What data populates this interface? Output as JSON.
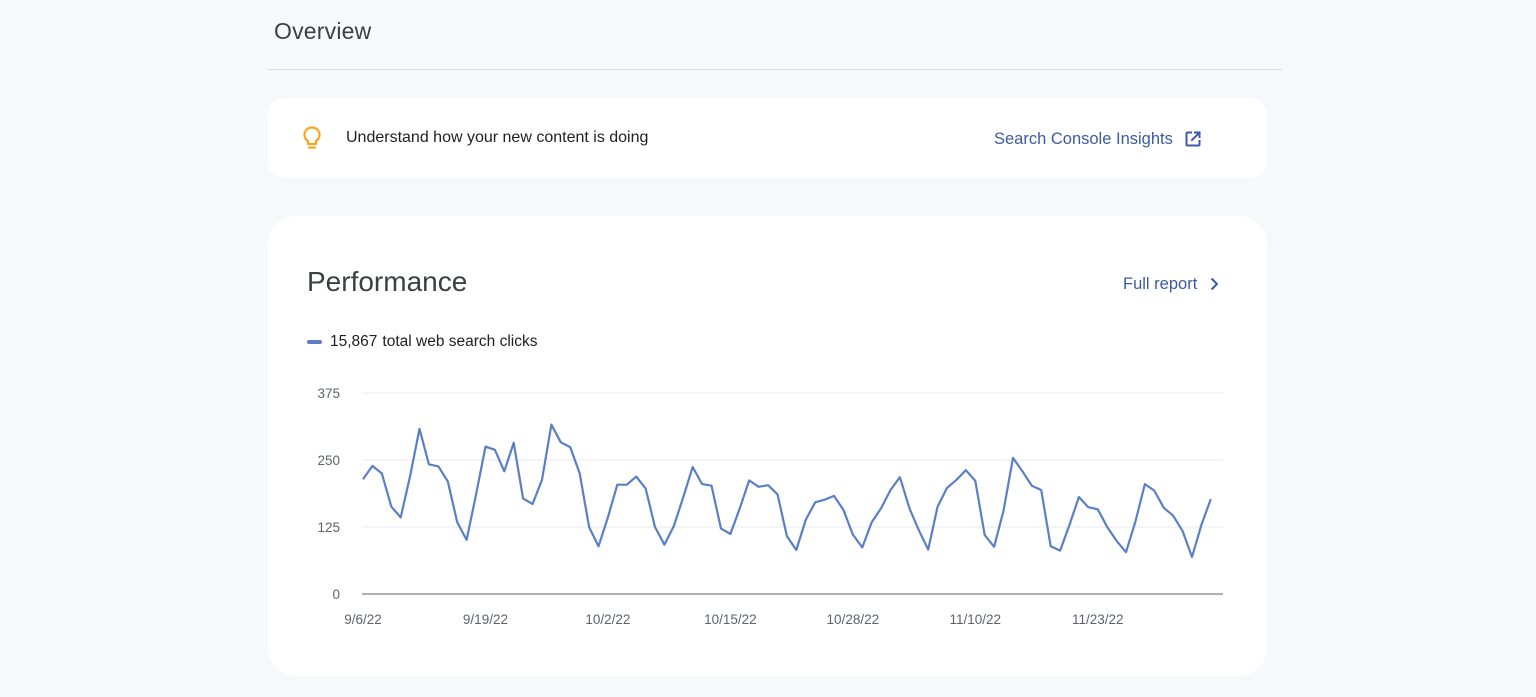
{
  "overview": {
    "title": "Overview"
  },
  "insights": {
    "message": "Understand how your new content is doing",
    "link_label": "Search Console Insights",
    "icon": "lightbulb-icon",
    "link_icon": "open-in-new-icon"
  },
  "performance": {
    "title": "Performance",
    "full_report_label": "Full report",
    "full_report_icon": "chevron-right-icon",
    "legend": {
      "value": "15,867",
      "label": "total web search clicks"
    }
  },
  "colors": {
    "accent": "#3c5aa6",
    "series": "#5b7fc5",
    "bulb": "#f5a623"
  },
  "chart_data": {
    "type": "line",
    "ylim": [
      0,
      375
    ],
    "yticks": [
      0,
      125,
      250,
      375
    ],
    "xticks": [
      "9/6/22",
      "9/19/22",
      "10/2/22",
      "10/15/22",
      "10/28/22",
      "11/10/22",
      "11/23/22"
    ],
    "grid": true,
    "series": [
      {
        "name": "total web search clicks",
        "start_date": "9/6/22",
        "values": [
          214,
          239,
          225,
          163,
          143,
          220,
          308,
          242,
          238,
          210,
          134,
          101,
          185,
          275,
          269,
          229,
          282,
          178,
          168,
          213,
          316,
          283,
          274,
          225,
          125,
          89,
          143,
          204,
          204,
          219,
          197,
          125,
          92,
          127,
          181,
          237,
          205,
          202,
          122,
          112,
          160,
          212,
          200,
          203,
          186,
          108,
          82,
          138,
          171,
          176,
          183,
          157,
          111,
          87,
          134,
          160,
          194,
          218,
          160,
          119,
          83,
          163,
          198,
          213,
          231,
          211,
          110,
          88,
          156,
          254,
          229,
          202,
          194,
          89,
          81,
          129,
          181,
          162,
          158,
          125,
          99,
          78,
          135,
          205,
          193,
          161,
          146,
          118,
          69,
          129,
          177
        ]
      }
    ]
  }
}
